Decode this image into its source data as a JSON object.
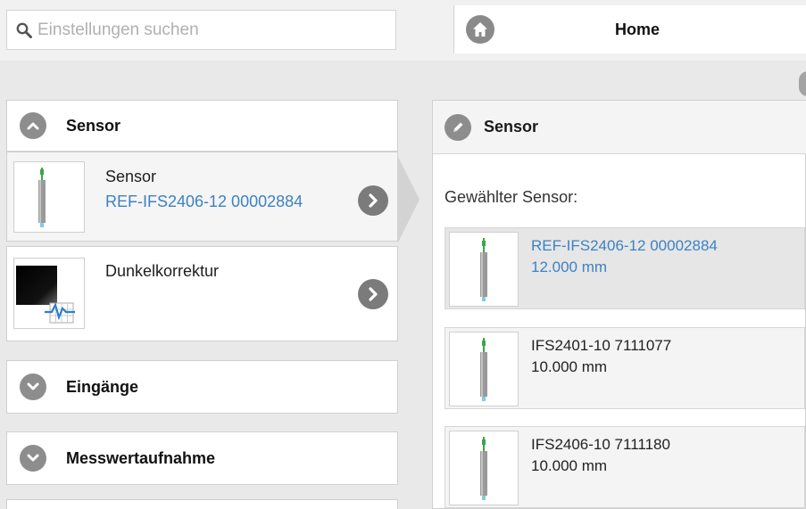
{
  "search": {
    "placeholder": "Einstellungen suchen"
  },
  "header": {
    "title": "Home",
    "home_icon": "home-icon"
  },
  "left": {
    "open_section": {
      "label": "Sensor",
      "icon": "chevron-up-icon"
    },
    "cards": [
      {
        "title": "Sensor",
        "subtitle": "REF-IFS2406-12 00002884",
        "icon": "sensor-probe-icon",
        "action_icon": "chevron-right-icon"
      },
      {
        "title": "Dunkelkorrektur",
        "icon": "dark-correction-icon",
        "action_icon": "chevron-right-icon"
      }
    ],
    "collapsed_sections": [
      {
        "label": "Eingänge",
        "icon": "chevron-down-icon"
      },
      {
        "label": "Messwertaufnahme",
        "icon": "chevron-down-icon"
      }
    ]
  },
  "right": {
    "panel_title": "Sensor",
    "panel_icon": "pencil-icon",
    "chosen_label": "Gewählter Sensor:",
    "sensors": [
      {
        "name": "REF-IFS2406-12 00002884",
        "range": "12.000 mm",
        "selected": true
      },
      {
        "name": "IFS2401-10 7111077",
        "range": "10.000 mm",
        "selected": false
      },
      {
        "name": "IFS2406-10 7111180",
        "range": "10.000 mm",
        "selected": false
      }
    ]
  },
  "colors": {
    "accent_link": "#3c82c4",
    "icon_grey": "#8d8d8d",
    "background": "#e9e9e9"
  }
}
